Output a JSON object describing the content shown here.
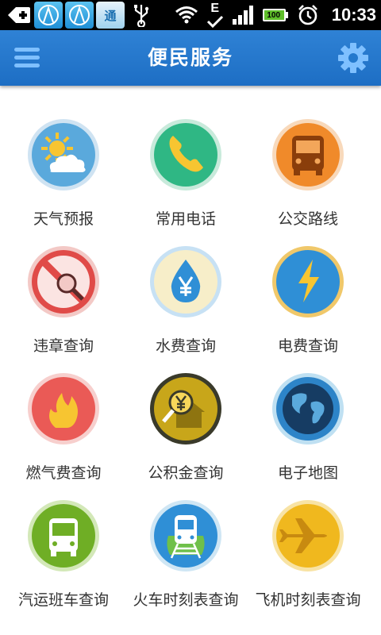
{
  "status_bar": {
    "time": "10:33",
    "battery": "100",
    "network_type": "E",
    "notification_tile_label": "通",
    "icons": [
      "usb-debug-icon",
      "notification-app-icon",
      "usb-icon",
      "wifi-icon",
      "edge-network-icon",
      "signal-icon",
      "battery-icon",
      "alarm-icon"
    ]
  },
  "header": {
    "title": "便民服务",
    "menu_icon": "hamburger-menu-icon",
    "settings_icon": "gear-icon"
  },
  "services": [
    {
      "label": "天气预报",
      "icon": "weather-icon",
      "color": "#5aa9dc"
    },
    {
      "label": "常用电话",
      "icon": "phone-icon",
      "color": "#2fb784"
    },
    {
      "label": "公交路线",
      "icon": "bus-icon",
      "color": "#f08a2a"
    },
    {
      "label": "违章查询",
      "icon": "no-parking-search-icon",
      "color": "#e04b48"
    },
    {
      "label": "水费查询",
      "icon": "water-drop-yen-icon",
      "color": "#2f8fd6"
    },
    {
      "label": "电费查询",
      "icon": "lightning-icon",
      "color": "#2f8fd6"
    },
    {
      "label": "燃气费查询",
      "icon": "flame-icon",
      "color": "#ea5a56"
    },
    {
      "label": "公积金查询",
      "icon": "house-yen-magnifier-icon",
      "color": "#c8a61a"
    },
    {
      "label": "电子地图",
      "icon": "globe-icon",
      "color": "#2d84c8"
    },
    {
      "label": "汽运班车查询",
      "icon": "coach-bus-icon",
      "color": "#6fae25"
    },
    {
      "label": "火车时刻表查询",
      "icon": "train-icon",
      "color": "#2f8fd6"
    },
    {
      "label": "飞机时刻表查询",
      "icon": "airplane-icon",
      "color": "#f0b81e"
    }
  ]
}
